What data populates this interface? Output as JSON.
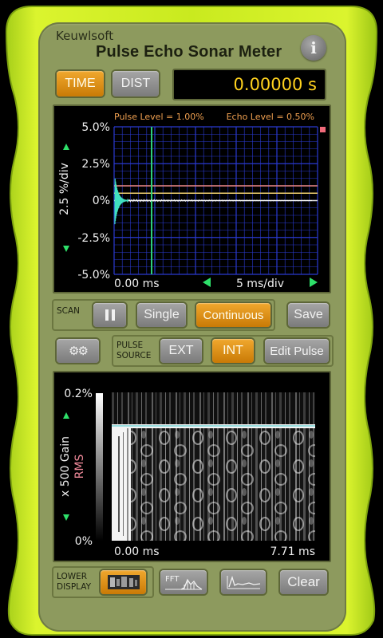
{
  "app": {
    "brand": "Keuwlsoft",
    "title": "Pulse Echo Sonar Meter",
    "info_label": "i"
  },
  "mode": {
    "time_label": "TIME",
    "dist_label": "DIST",
    "readout": "0.00000 s"
  },
  "upper_scope": {
    "pulse_level_label": "Pulse Level = 1.00%",
    "echo_level_label": "Echo Level = 0.50%",
    "y_ticks": [
      "5.0%",
      "2.5%",
      "0%",
      "-2.5%",
      "-5.0%"
    ],
    "y_unit_label": "2.5 %/div",
    "x_start": "0.00 ms",
    "x_div": "5 ms/div",
    "colors": {
      "pulse_line": "#f08a8a",
      "echo_line": "#f0d070",
      "trace": "#40e0c0",
      "cursor": "#2ecf7a",
      "grid": "#2a3ad0"
    }
  },
  "scan": {
    "label": "SCAN",
    "pause_icon": "pause-icon",
    "single_label": "Single",
    "continuous_label": "Continuous",
    "save_label": "Save"
  },
  "pulse_source": {
    "settings_icon": "gear-icon",
    "label_line1": "PULSE",
    "label_line2": "SOURCE",
    "ext_label": "EXT",
    "int_label": "INT",
    "edit_label": "Edit Pulse"
  },
  "lower_scope": {
    "y_top": "0.2%",
    "y_bottom": "0%",
    "gain_label": "x 500 Gain",
    "rms_label": "RMS",
    "x_start": "0.00 ms",
    "x_end": "7.71 ms"
  },
  "lower_display": {
    "label_line1": "LOWER",
    "label_line2": "DISPLAY",
    "fft_label": "FFT",
    "clear_label": "Clear"
  }
}
